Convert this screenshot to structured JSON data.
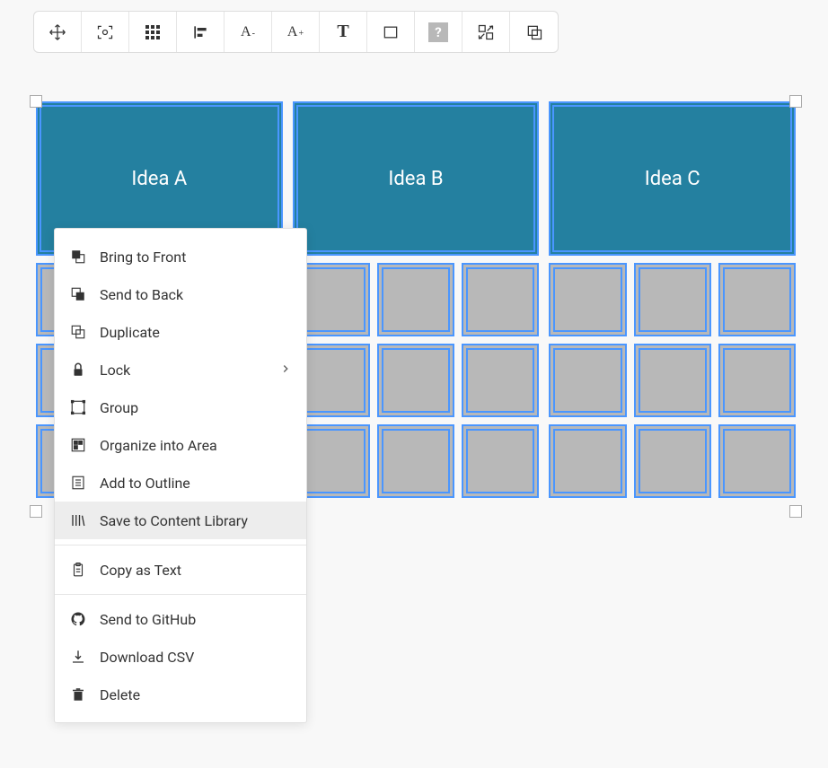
{
  "toolbar": {
    "icons": [
      "move",
      "focus",
      "grid-dots",
      "align",
      "font-decrease",
      "font-increase",
      "text-style",
      "rectangle",
      "help",
      "swap",
      "send-behind"
    ]
  },
  "ideas": [
    {
      "label": "Idea A"
    },
    {
      "label": "Idea B"
    },
    {
      "label": "Idea C"
    }
  ],
  "grid": {
    "rows": 3,
    "groups": 3,
    "cellsPerGroup": 3
  },
  "contextMenu": {
    "items": [
      {
        "id": "bring-to-front",
        "label": "Bring to Front",
        "icon": "bring-front"
      },
      {
        "id": "send-to-back",
        "label": "Send to Back",
        "icon": "send-back"
      },
      {
        "id": "duplicate",
        "label": "Duplicate",
        "icon": "duplicate"
      },
      {
        "id": "lock",
        "label": "Lock",
        "icon": "lock",
        "submenu": true
      },
      {
        "id": "group",
        "label": "Group",
        "icon": "group"
      },
      {
        "id": "organize-area",
        "label": "Organize into Area",
        "icon": "organize"
      },
      {
        "id": "add-outline",
        "label": "Add to Outline",
        "icon": "outline"
      },
      {
        "id": "save-library",
        "label": "Save to Content Library",
        "icon": "library",
        "highlighted": true
      },
      {
        "separator": true
      },
      {
        "id": "copy-text",
        "label": "Copy as Text",
        "icon": "clipboard"
      },
      {
        "separator": true
      },
      {
        "id": "send-github",
        "label": "Send to GitHub",
        "icon": "github"
      },
      {
        "id": "download-csv",
        "label": "Download CSV",
        "icon": "download"
      },
      {
        "id": "delete",
        "label": "Delete",
        "icon": "trash"
      }
    ]
  }
}
